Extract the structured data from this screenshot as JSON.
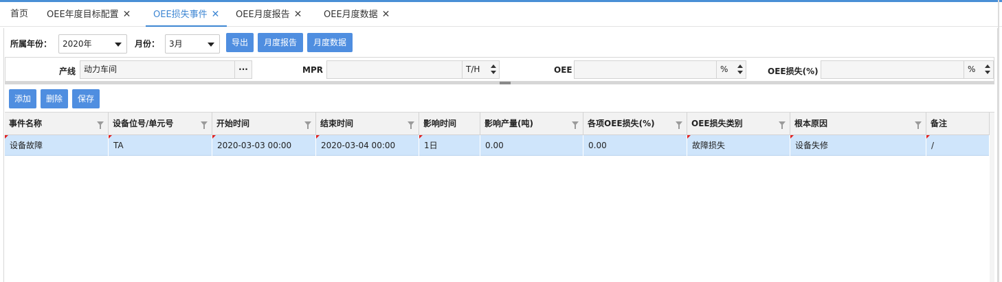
{
  "tabs": [
    {
      "label": "首页",
      "closable": false,
      "active": false
    },
    {
      "label": "OEE年度目标配置",
      "closable": true,
      "active": false
    },
    {
      "label": "OEE损失事件",
      "closable": true,
      "active": true
    },
    {
      "label": "OEE月度报告",
      "closable": true,
      "active": false
    },
    {
      "label": "OEE月度数据",
      "closable": true,
      "active": false
    }
  ],
  "close_glyph": "✕",
  "filter": {
    "year_label": "所属年份：",
    "year_value": "2020年",
    "month_label": "月份：",
    "month_value": "3月",
    "export_label": "导出",
    "monthly_report_label": "月度报告",
    "monthly_data_label": "月度数据"
  },
  "form": {
    "line_label": "产线",
    "line_value": "动力车间",
    "line_picker": "···",
    "mpr_label": "MPR",
    "mpr_value": "",
    "mpr_unit": "T/H",
    "oee_label": "OEE",
    "oee_value": "",
    "oee_unit": "%",
    "oee_loss_label": "OEE损失(%)",
    "oee_loss_value": "",
    "oee_loss_unit": "%"
  },
  "actions": {
    "add_label": "添加",
    "delete_label": "删除",
    "save_label": "保存"
  },
  "grid": {
    "columns": [
      "事件名称",
      "设备位号/单元号",
      "开始时间",
      "结束时间",
      "影响时间",
      "影响产量(吨)",
      "各项OEE损失(%)",
      "OEE损失类别",
      "根本原因",
      "备注"
    ],
    "rows": [
      [
        "设备故障",
        "TA",
        "2020-03-03 00:00",
        "2020-03-04 00:00",
        "1日",
        "0.00",
        "0.00",
        "故障损失",
        "设备失修",
        "/"
      ]
    ]
  },
  "colors": {
    "accent": "#3d86d3",
    "button": "#4f8ee0",
    "selected_row": "#cfe5fb",
    "dirty_marker": "#e02020"
  }
}
